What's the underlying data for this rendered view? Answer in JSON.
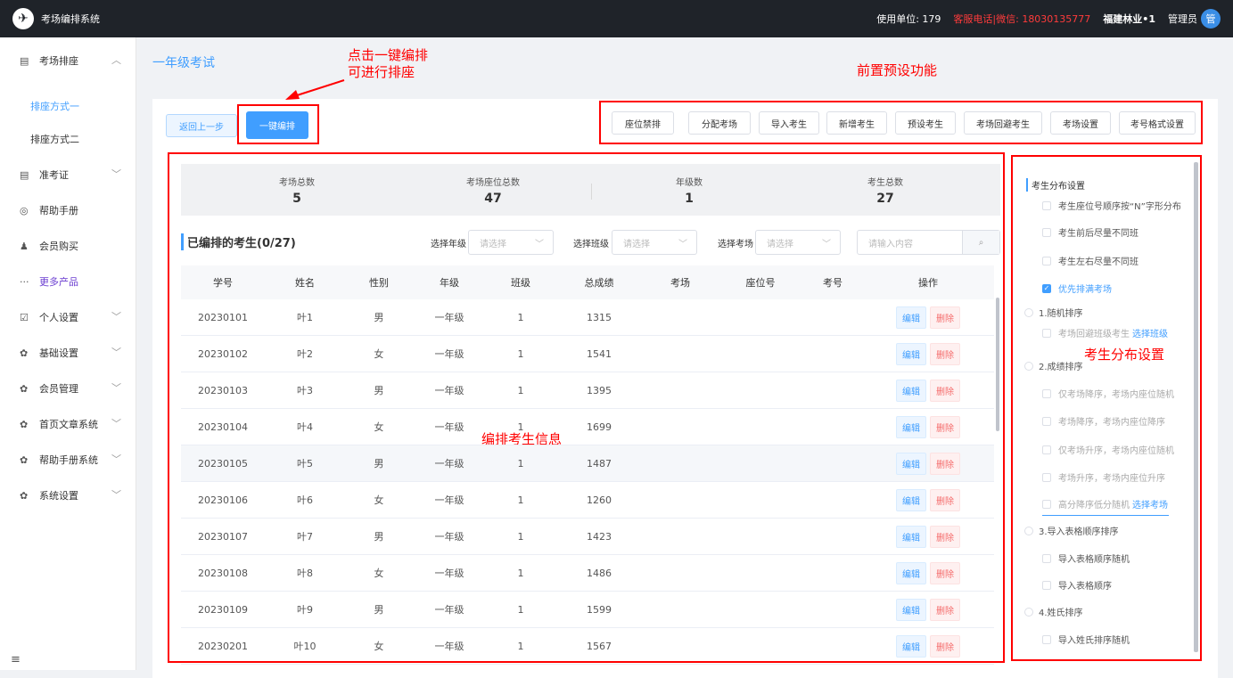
{
  "topbar": {
    "app_title": "考场编排系统",
    "unit_label": "使用单位: 179",
    "service_phone": "客服电话|微信: 18030135777",
    "org": "福建林业•1",
    "role": "管理员",
    "avatar_text": "管"
  },
  "sidebar": {
    "items": [
      {
        "label": "考场排座",
        "icon": "building-icon",
        "expanded": true
      },
      {
        "label": "准考证",
        "icon": "building-icon"
      },
      {
        "label": "帮助手册",
        "icon": "help-circle-icon"
      },
      {
        "label": "会员购买",
        "icon": "user-icon"
      },
      {
        "label": "更多产品",
        "icon": "more-icon"
      },
      {
        "label": "个人设置",
        "icon": "edit-icon"
      },
      {
        "label": "基础设置",
        "icon": "gear-icon"
      },
      {
        "label": "会员管理",
        "icon": "gear-icon"
      },
      {
        "label": "首页文章系统",
        "icon": "gear-icon"
      },
      {
        "label": "帮助手册系统",
        "icon": "gear-icon"
      },
      {
        "label": "系统设置",
        "icon": "gear-icon"
      }
    ],
    "subitems": [
      "排座方式一",
      "排座方式二"
    ]
  },
  "page": {
    "title": "一年级考试"
  },
  "annotations": {
    "one_click_line1": "点击一键编排",
    "one_click_line2": "可进行排座",
    "preset": "前置预设功能",
    "student_info": "编排考生信息",
    "distribution": "考生分布设置"
  },
  "toolbar": {
    "back": "返回上一步",
    "one_click": "一键编排",
    "presets": [
      "座位禁排",
      "分配考场",
      "导入考生",
      "新增考生",
      "预设考生",
      "考场回避考生",
      "考场设置",
      "考号格式设置"
    ]
  },
  "stats": [
    {
      "label": "考场总数",
      "value": "5"
    },
    {
      "label": "考场座位总数",
      "value": "47"
    },
    {
      "label": "年级数",
      "value": "1"
    },
    {
      "label": "考生总数",
      "value": "27"
    }
  ],
  "filters": {
    "section_title": "已编排的考生(0/27)",
    "grade_label": "选择年级",
    "class_label": "选择班级",
    "room_label": "选择考场",
    "placeholder": "请选择",
    "search_placeholder": "请输入内容"
  },
  "table": {
    "headers": [
      "学号",
      "姓名",
      "性别",
      "年级",
      "班级",
      "总成绩",
      "考场",
      "座位号",
      "考号",
      "操作"
    ],
    "edit": "编辑",
    "delete": "删除",
    "rows": [
      [
        "20230101",
        "叶1",
        "男",
        "一年级",
        "1",
        "1315"
      ],
      [
        "20230102",
        "叶2",
        "女",
        "一年级",
        "1",
        "1541"
      ],
      [
        "20230103",
        "叶3",
        "男",
        "一年级",
        "1",
        "1395"
      ],
      [
        "20230104",
        "叶4",
        "女",
        "一年级",
        "1",
        "1699"
      ],
      [
        "20230105",
        "叶5",
        "男",
        "一年级",
        "1",
        "1487"
      ],
      [
        "20230106",
        "叶6",
        "女",
        "一年级",
        "1",
        "1260"
      ],
      [
        "20230107",
        "叶7",
        "男",
        "一年级",
        "1",
        "1423"
      ],
      [
        "20230108",
        "叶8",
        "女",
        "一年级",
        "1",
        "1486"
      ],
      [
        "20230109",
        "叶9",
        "男",
        "一年级",
        "1",
        "1599"
      ],
      [
        "20230201",
        "叶10",
        "女",
        "一年级",
        "1",
        "1567"
      ]
    ]
  },
  "distribution": {
    "title": "考生分布设置",
    "opt_n": "考生座位号顺序按“N”字形分布",
    "opt_front_back": "考生前后尽量不同班",
    "opt_left_right": "考生左右尽量不同班",
    "opt_fill": "优先排满考场",
    "random": "1.随机排序",
    "random_avoid": "考场回避班级考生",
    "select_class": "选择班级",
    "score": "2.成绩排序",
    "score_opts": [
      "仅考场降序，考场内座位随机",
      "考场降序，考场内座位降序",
      "仅考场升序，考场内座位随机",
      "考场升序，考场内座位升序"
    ],
    "score_high_low": "高分降序低分随机",
    "select_room": "选择考场",
    "import_order": "3.导入表格顺序排序",
    "import_random": "导入表格顺序随机",
    "import_seq": "导入表格顺序",
    "surname": "4.姓氏排序",
    "surname_random": "导入姓氏排序随机"
  }
}
